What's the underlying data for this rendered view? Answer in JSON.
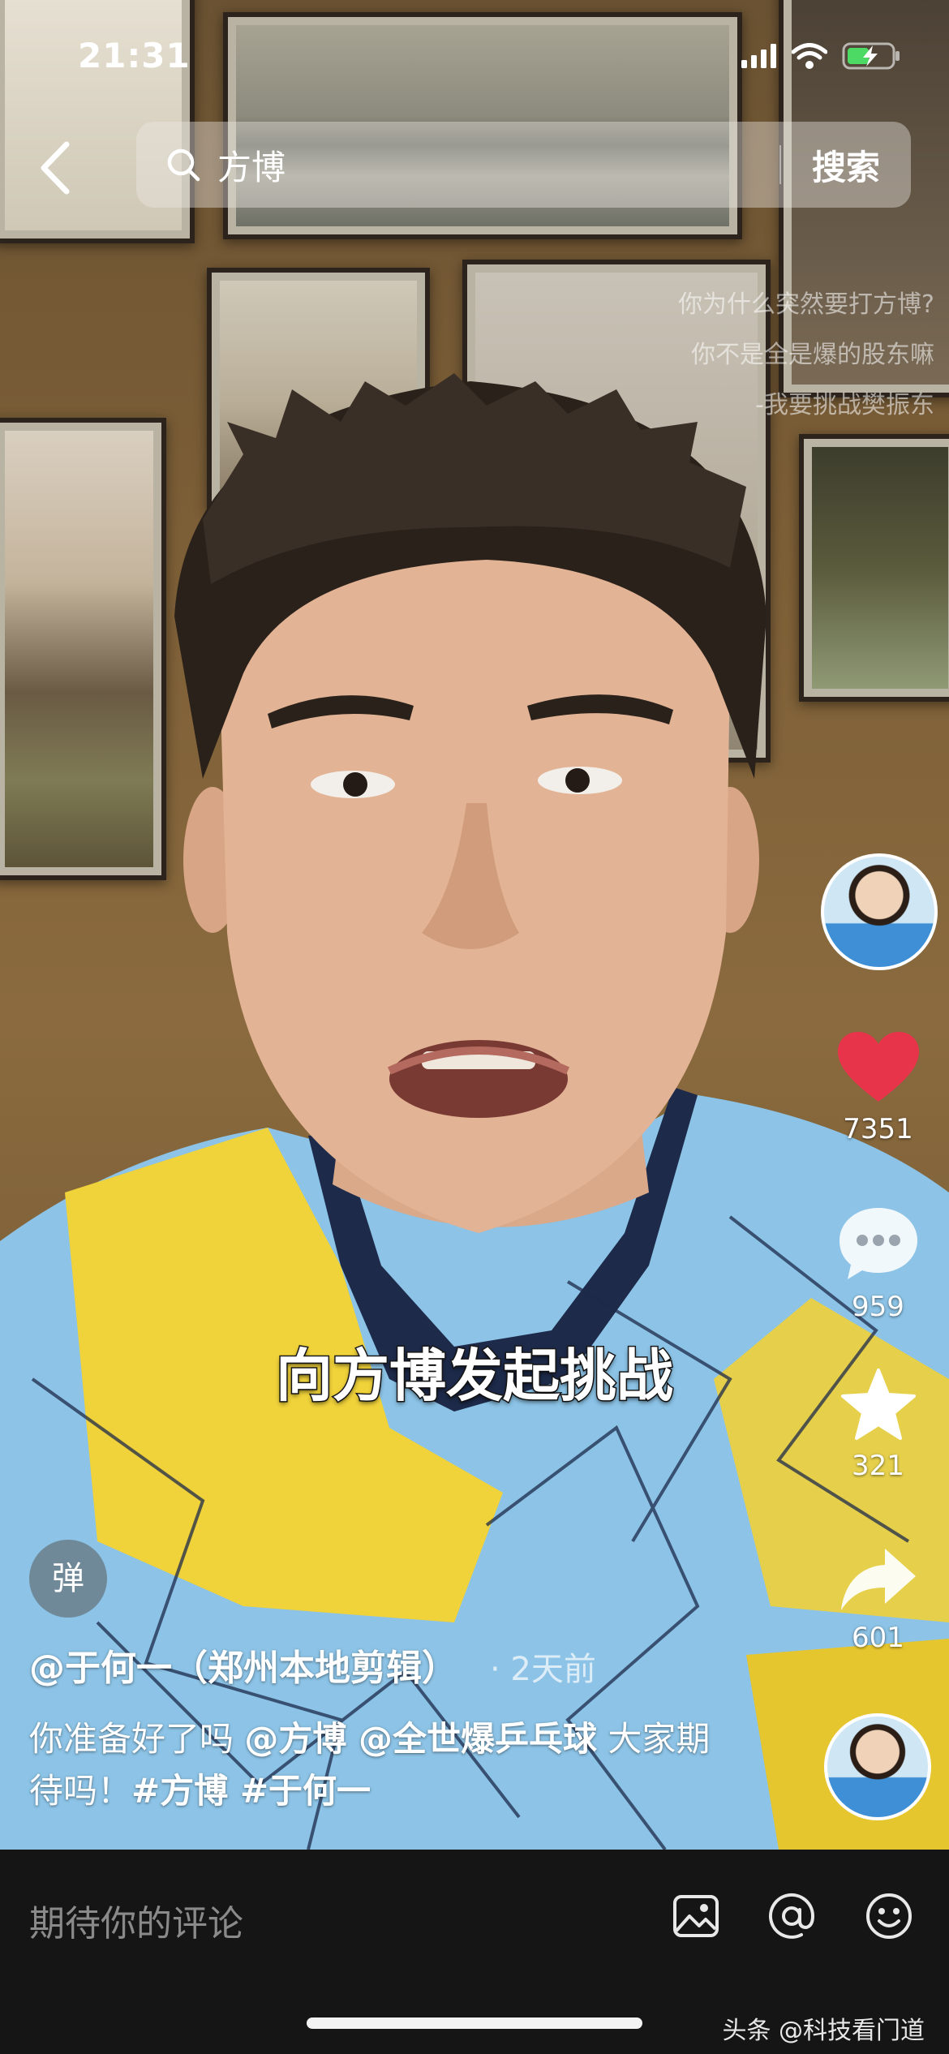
{
  "status_bar": {
    "time": "21:31"
  },
  "search": {
    "query": "方博",
    "button_label": "搜索"
  },
  "video": {
    "overlay_quote": [
      "你为什么突然要打方博?",
      "你不是全是爆的股东嘛",
      "-我要挑战樊振东"
    ],
    "caption": "向方博发起挑战"
  },
  "actions": {
    "likes": "7351",
    "comments": "959",
    "favorites": "321",
    "shares": "601"
  },
  "danmu_label": "弹",
  "author": {
    "name": "@于何一（郑州本地剪辑）",
    "time": "· 2天前"
  },
  "description": {
    "text1": "你准备好了吗 ",
    "mention1": "@方博",
    "mention2": " @全世爆乒乓球",
    "text2": " 大家期待吗！",
    "tag1": "#方博",
    "tag2": " #于何一"
  },
  "comment_bar": {
    "placeholder": "期待你的评论"
  },
  "watermark": "头条 @科技看门道",
  "colors": {
    "like_red": "#e8344a",
    "bottom_bar": "#151515"
  }
}
